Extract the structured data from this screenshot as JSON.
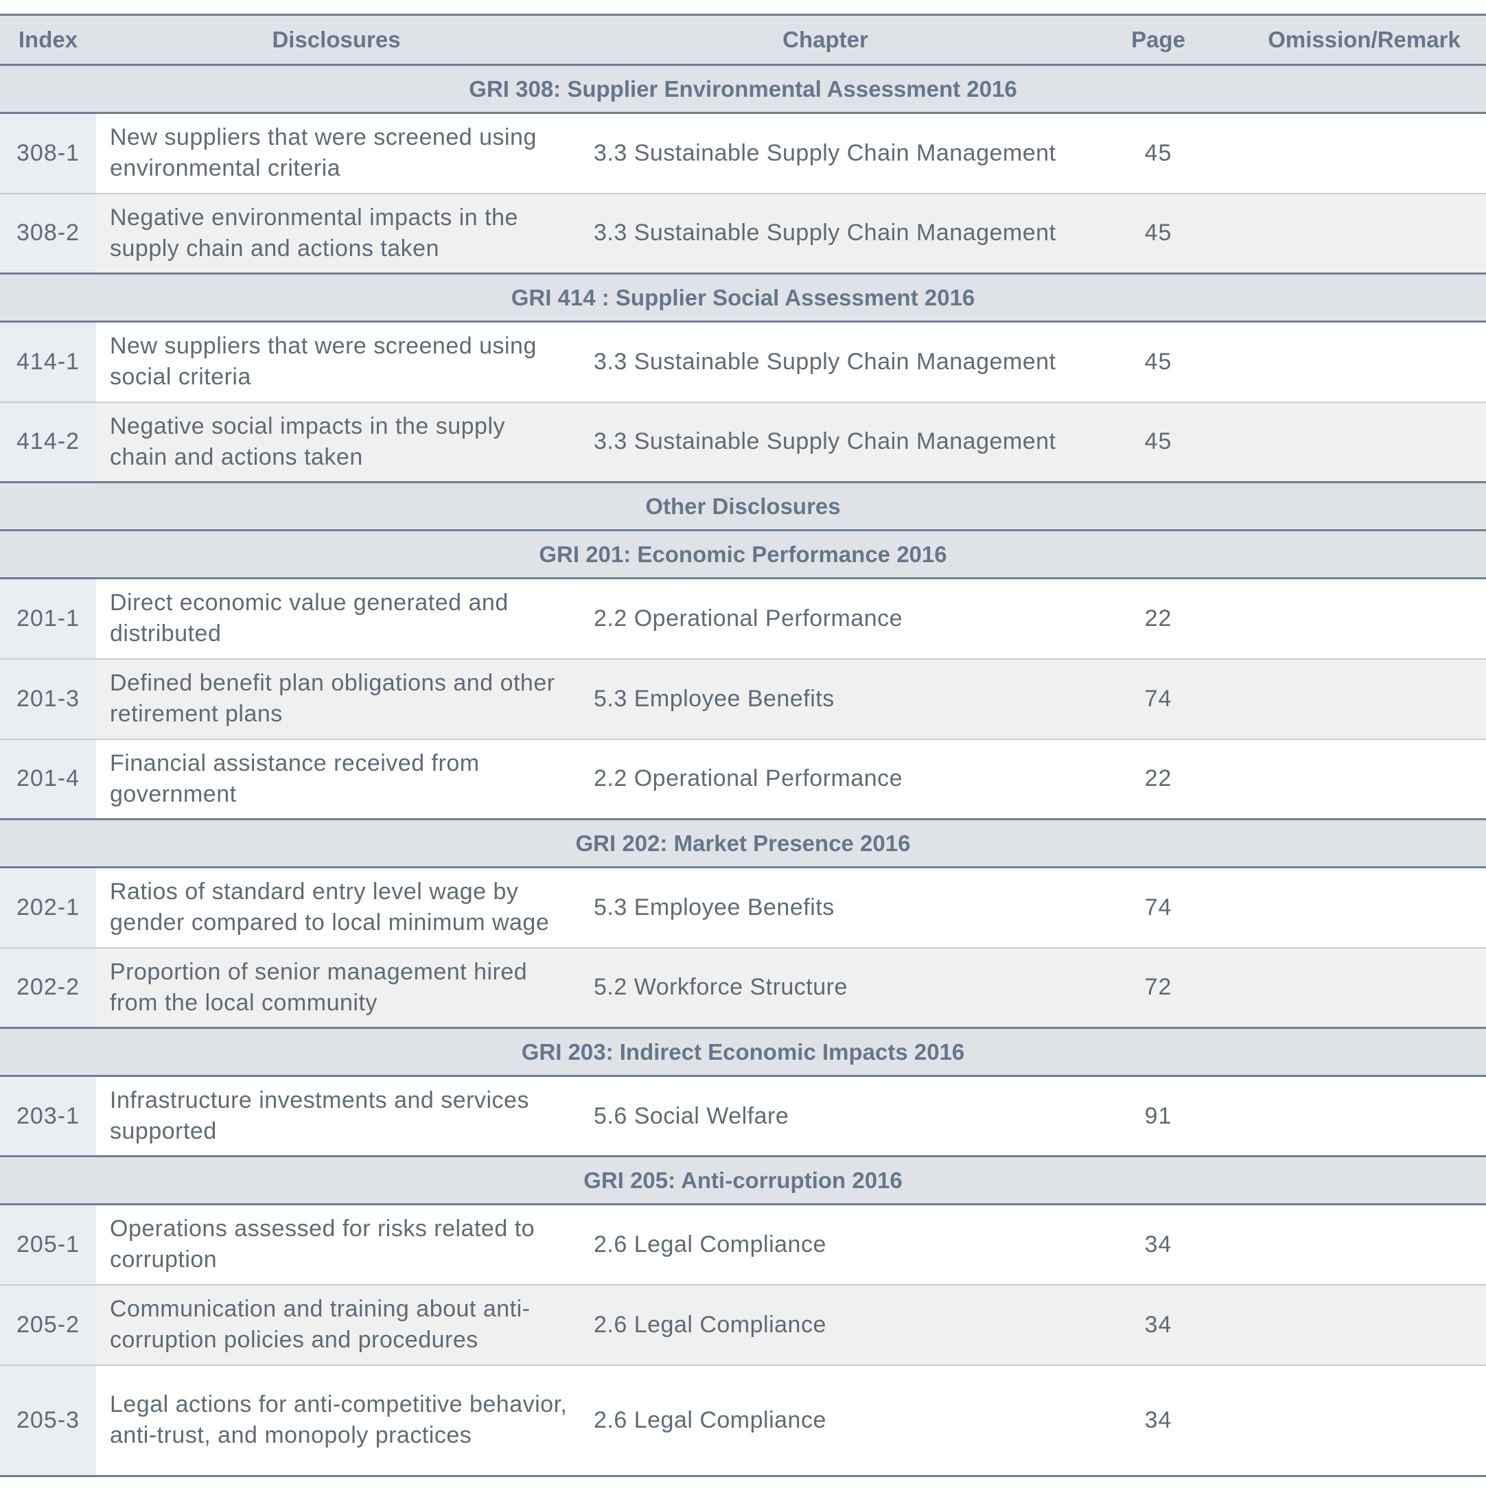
{
  "headers": {
    "index": "Index",
    "disclosures": "Disclosures",
    "chapter": "Chapter",
    "page": "Page",
    "omission": "Omission/Remark"
  },
  "sections": [
    {
      "title": "GRI 308: Supplier Environmental Assessment 2016",
      "rows": [
        {
          "index": "308-1",
          "disclosure": "New suppliers that were screened using environmental criteria",
          "chapter": "3.3 Sustainable Supply Chain Management",
          "page": "45",
          "remark": ""
        },
        {
          "index": "308-2",
          "disclosure": "Negative environmental impacts in the supply chain and actions taken",
          "chapter": "3.3 Sustainable Supply Chain Management",
          "page": "45",
          "remark": ""
        }
      ]
    },
    {
      "title": "GRI 414 : Supplier Social Assessment 2016",
      "rows": [
        {
          "index": "414-1",
          "disclosure": "New suppliers that were screened using social criteria",
          "chapter": "3.3 Sustainable Supply Chain Management",
          "page": "45",
          "remark": ""
        },
        {
          "index": "414-2",
          "disclosure": "Negative social impacts in the supply chain and actions taken",
          "chapter": "3.3 Sustainable Supply Chain Management",
          "page": "45",
          "remark": ""
        }
      ]
    },
    {
      "title": "Other Disclosures",
      "rows": []
    },
    {
      "title": "GRI 201: Economic Performance 2016",
      "rows": [
        {
          "index": "201-1",
          "disclosure": "Direct economic value generated and distributed",
          "chapter": "2.2 Operational Performance",
          "page": "22",
          "remark": ""
        },
        {
          "index": "201-3",
          "disclosure": "Defined benefit plan obligations and other retirement plans",
          "chapter": "5.3 Employee Benefits",
          "page": "74",
          "remark": ""
        },
        {
          "index": "201-4",
          "disclosure": "Financial assistance received from government",
          "chapter": "2.2 Operational Performance",
          "page": "22",
          "remark": ""
        }
      ]
    },
    {
      "title": "GRI 202: Market Presence 2016",
      "rows": [
        {
          "index": "202-1",
          "disclosure": "Ratios of standard entry level wage by gender compared to local minimum wage",
          "chapter": "5.3 Employee Benefits",
          "page": "74",
          "remark": ""
        },
        {
          "index": "202-2",
          "disclosure": "Proportion of senior management hired from the local community",
          "chapter": "5.2 Workforce Structure",
          "page": "72",
          "remark": ""
        }
      ]
    },
    {
      "title": "GRI 203: Indirect Economic Impacts 2016",
      "rows": [
        {
          "index": "203-1",
          "disclosure": "Infrastructure investments and services supported",
          "chapter": "5.6 Social Welfare",
          "page": "91",
          "remark": ""
        }
      ]
    },
    {
      "title": "GRI 205: Anti-corruption 2016",
      "rows": [
        {
          "index": "205-1",
          "disclosure": "Operations assessed for risks related to corruption",
          "chapter": "2.6 Legal Compliance",
          "page": "34",
          "remark": ""
        },
        {
          "index": "205-2",
          "disclosure": "Communication and training about anti-corruption policies and procedures",
          "chapter": "2.6 Legal Compliance",
          "page": "34",
          "remark": ""
        },
        {
          "index": "205-3",
          "disclosure": "Legal actions for anti-competitive behavior, anti-trust, and monopoly practices",
          "chapter": "2.6 Legal Compliance",
          "page": "34",
          "remark": ""
        }
      ]
    }
  ]
}
